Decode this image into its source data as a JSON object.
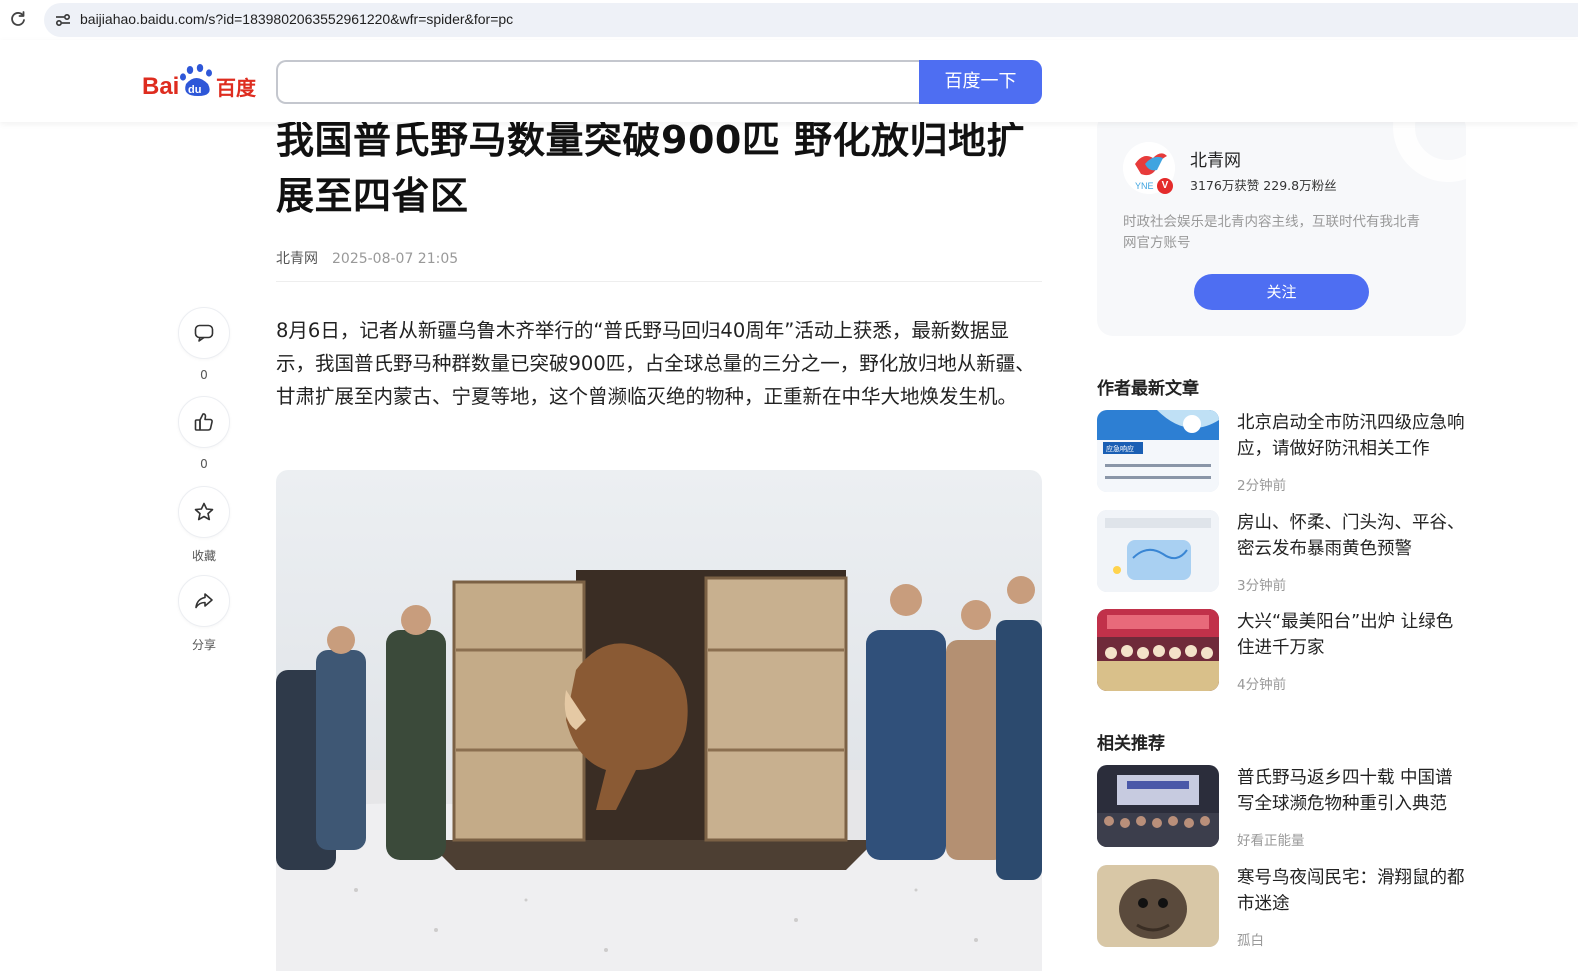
{
  "browser": {
    "url": "baijiahao.baidu.com/s?id=1839802063552961220&wfr=spider&for=pc"
  },
  "header": {
    "logo_text": "Bai du 百度",
    "search_value": "",
    "search_button": "百度一下",
    "brand_color": "#4e6ef2"
  },
  "article": {
    "title": "我国普氏野马数量突破900匹 野化放归地扩展至四省区",
    "source": "北青网",
    "date": "2025-08-07 21:05",
    "paragraph": "8月6日，记者从新疆乌鲁木齐举行的“普氏野马回归40周年”活动上获悉，最新数据显示，我国普氏野马种群数量已突破900匹，占全球总量的三分之一，野化放归地从新疆、甘肃扩展至内蒙古、宁夏等地，这个曾濒临灭绝的物种，正重新在中华大地焕发生机。"
  },
  "actions": {
    "comment_count": "0",
    "like_count": "0",
    "collect_label": "收藏",
    "share_label": "分享"
  },
  "author": {
    "name": "北青网",
    "stats": "3176万获赞 229.8万粉丝",
    "description": "时政社会娱乐是北青内容主线，互联时代有我北青网官方账号",
    "follow_label": "关注",
    "badge": "V"
  },
  "latest": {
    "section_title": "作者最新文章",
    "items": [
      {
        "title": "北京启动全市防汛四级应急响应，请做好防汛相关工作",
        "time": "2分钟前"
      },
      {
        "title": "房山、怀柔、门头沟、平谷、密云发布暴雨黄色预警",
        "time": "3分钟前"
      },
      {
        "title": "大兴“最美阳台”出炉 让绿色住进千万家",
        "time": "4分钟前"
      }
    ]
  },
  "related": {
    "section_title": "相关推荐",
    "items": [
      {
        "title": "普氏野马返乡四十载 中国谱写全球濒危物种重引入典范",
        "source": "好看正能量"
      },
      {
        "title": "寒号鸟夜闯民宅：滑翔鼠的都市迷途",
        "source": "孤白"
      }
    ]
  }
}
